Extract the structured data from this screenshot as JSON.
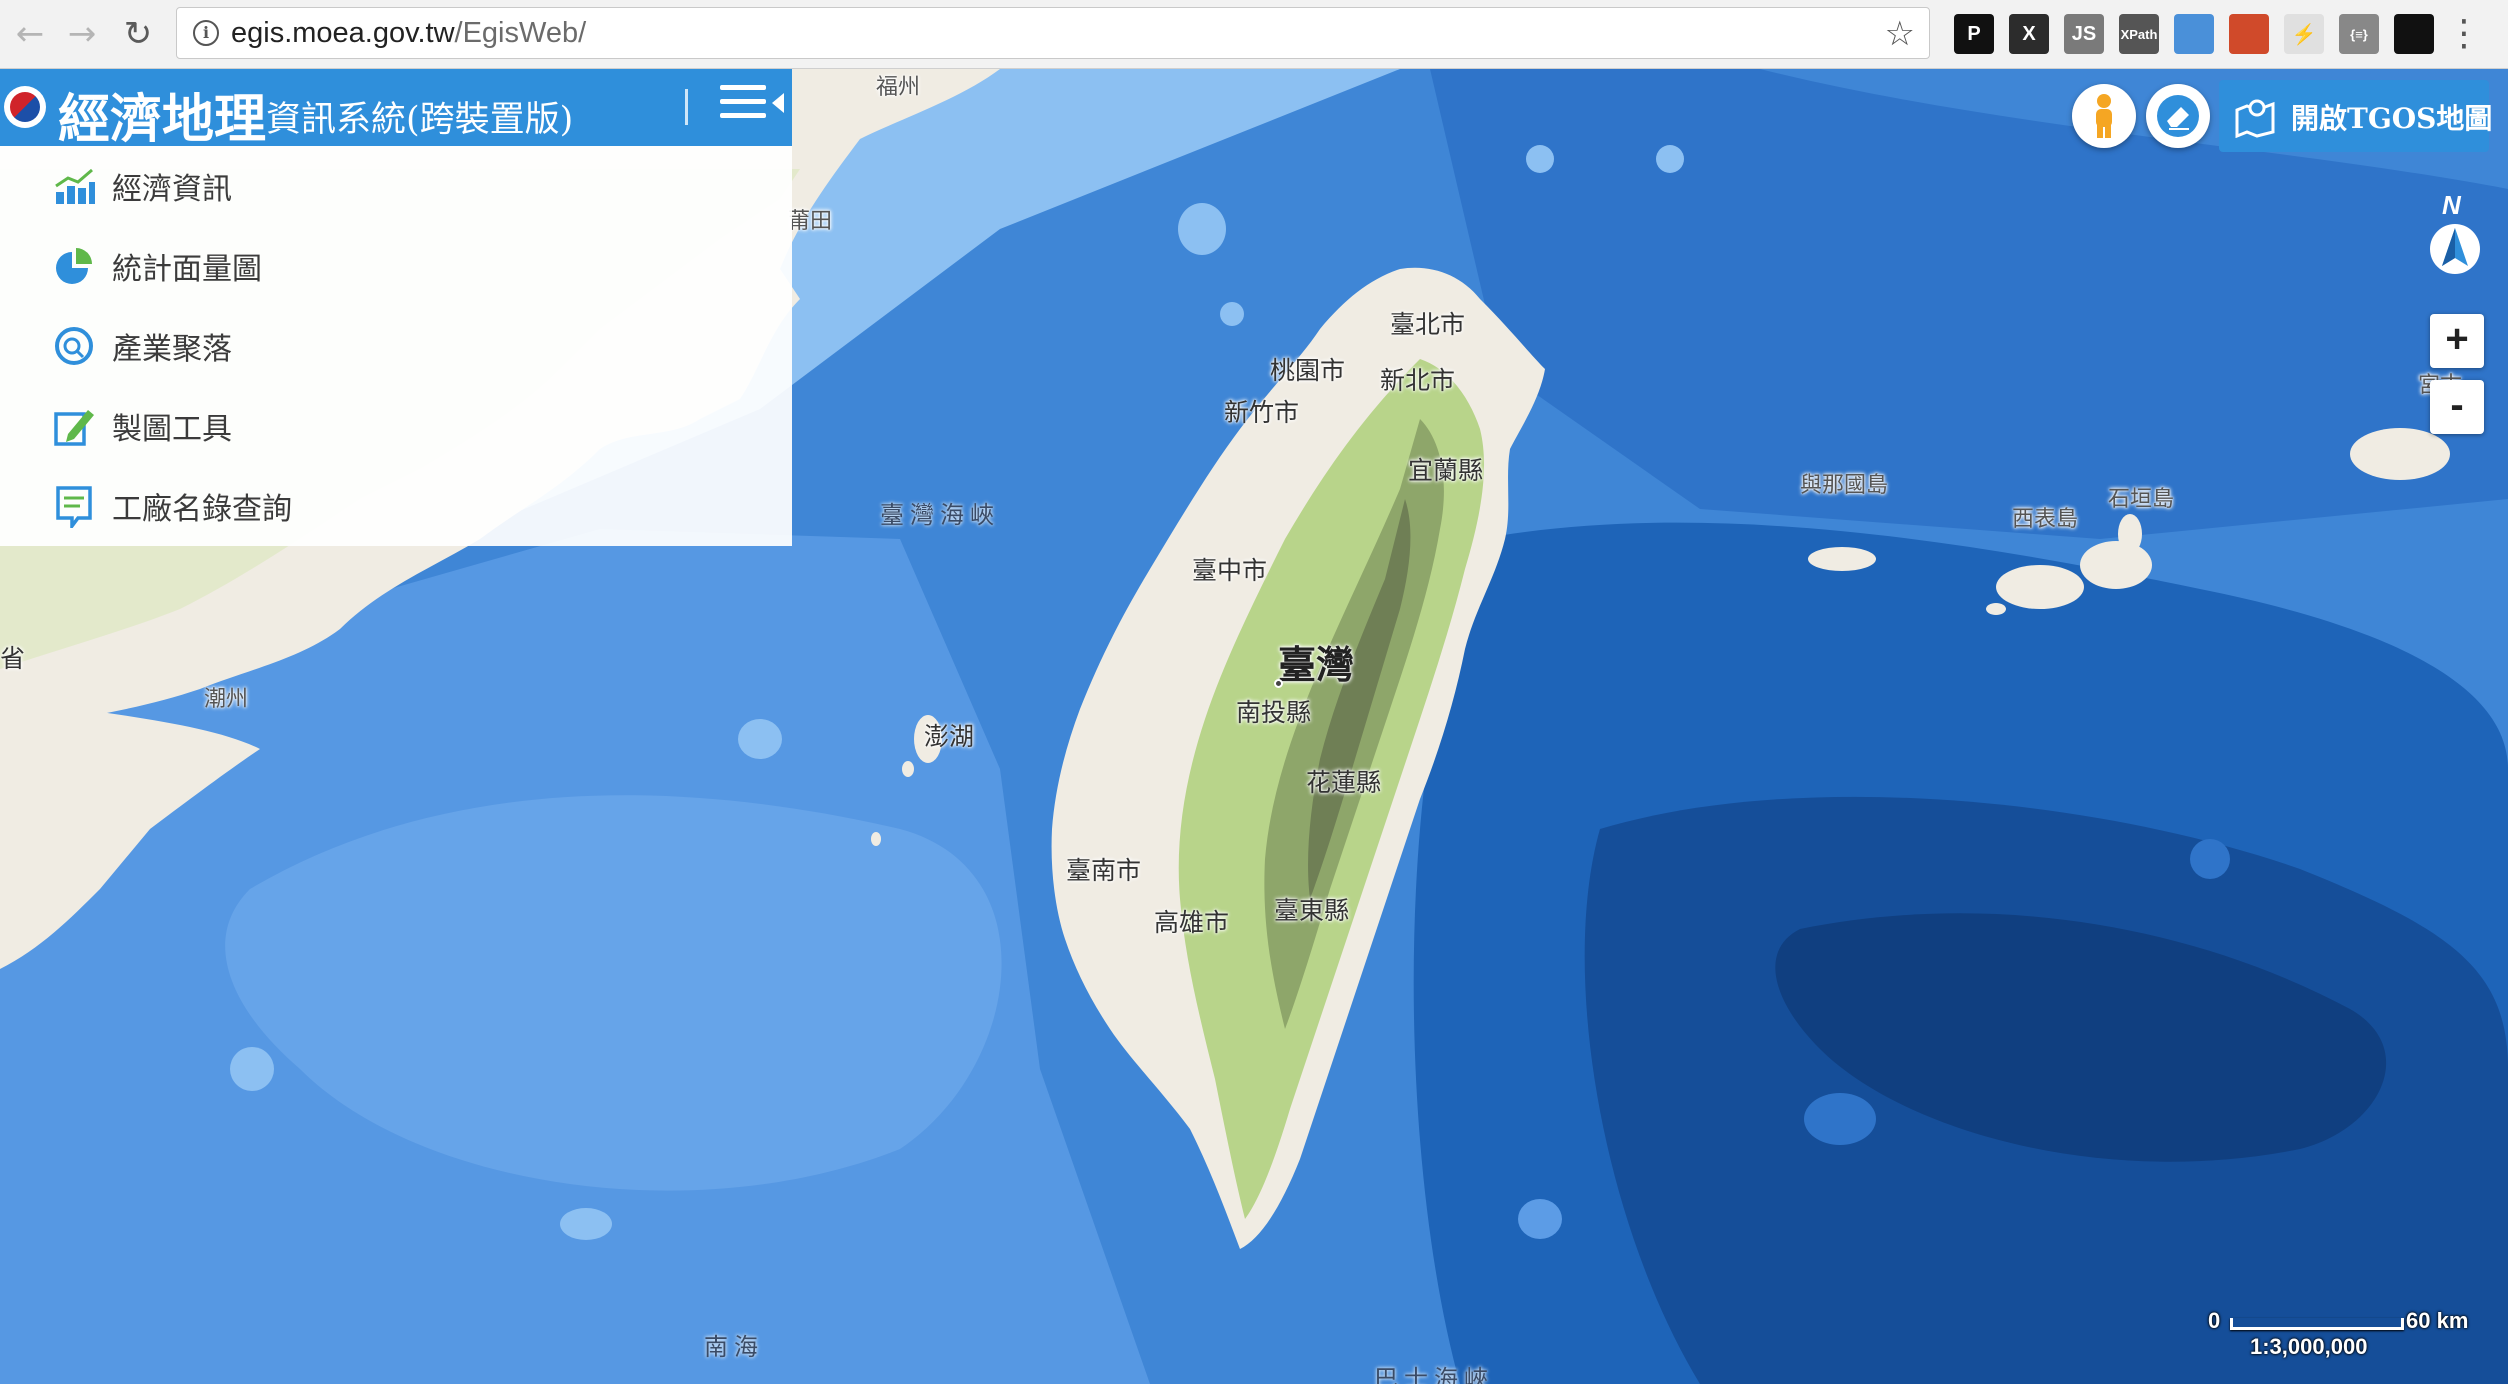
{
  "browser": {
    "back_icon": "←",
    "forward_icon": "→",
    "reload_icon": "↻",
    "url_host": "egis.moea.gov.tw",
    "url_path": "/EgisWeb/",
    "star_icon": "☆",
    "extensions": [
      {
        "name": "pocket-extension-icon",
        "label": "P",
        "color": "#111111"
      },
      {
        "name": "x-extension-icon",
        "label": "X",
        "color": "#2c2c2c"
      },
      {
        "name": "js-extension-icon",
        "label": "JS",
        "color": "#7a7a7a"
      },
      {
        "name": "xpath-extension-icon",
        "label": "XPath",
        "color": "#555555"
      },
      {
        "name": "inspector-extension-icon",
        "label": "",
        "color": "#4a90d9"
      },
      {
        "name": "cookie-extension-icon",
        "label": "",
        "color": "#d04a2a"
      },
      {
        "name": "flash-extension-icon",
        "label": "⚡",
        "color": "#e0e0e0"
      },
      {
        "name": "json-extension-icon",
        "label": "{≡}",
        "color": "#888888"
      },
      {
        "name": "hexagon-extension-icon",
        "label": "",
        "color": "#111111"
      }
    ],
    "menu_icon": "⋮"
  },
  "app": {
    "title": "經濟地理",
    "subtitle": "資訊系統(跨裝置版)",
    "brand_color": "#2f8fdb"
  },
  "menu": [
    {
      "label": "經濟資訊",
      "icon": "bar-chart-icon"
    },
    {
      "label": "統計面量圖",
      "icon": "pie-chart-icon"
    },
    {
      "label": "產業聚落",
      "icon": "cluster-search-icon"
    },
    {
      "label": "製圖工具",
      "icon": "edit-pencil-icon"
    },
    {
      "label": "工廠名錄查詢",
      "icon": "directory-book-icon"
    }
  ],
  "controls": {
    "tgos_label": "開啟TGOS地圖",
    "north_label": "N",
    "zoom_in": "+",
    "zoom_out": "-"
  },
  "map": {
    "labels": {
      "taiwan": "臺灣",
      "taipei": "臺北市",
      "taoyuan": "桃園市",
      "new_taipei": "新北市",
      "hsinchu": "新竹市",
      "yilan": "宜蘭縣",
      "taichung": "臺中市",
      "nantou": "南投縣",
      "hualien": "花蓮縣",
      "tainan": "臺南市",
      "kaohsiung": "高雄市",
      "taitung": "臺東縣",
      "penghu": "澎湖",
      "strait": "臺灣海峽",
      "yonaguni": "與那國島",
      "iriomote": "西表島",
      "ishigaki": "石垣島",
      "miyako": "宮古",
      "chaozhou": "潮州",
      "putian": "莆田",
      "province": "省",
      "south_sea": "南海",
      "bashi": "巴士海峽",
      "fuzhou": "福州"
    },
    "scale": {
      "zero": "0",
      "distance": "60 km",
      "ratio": "1:3,000,000"
    }
  }
}
